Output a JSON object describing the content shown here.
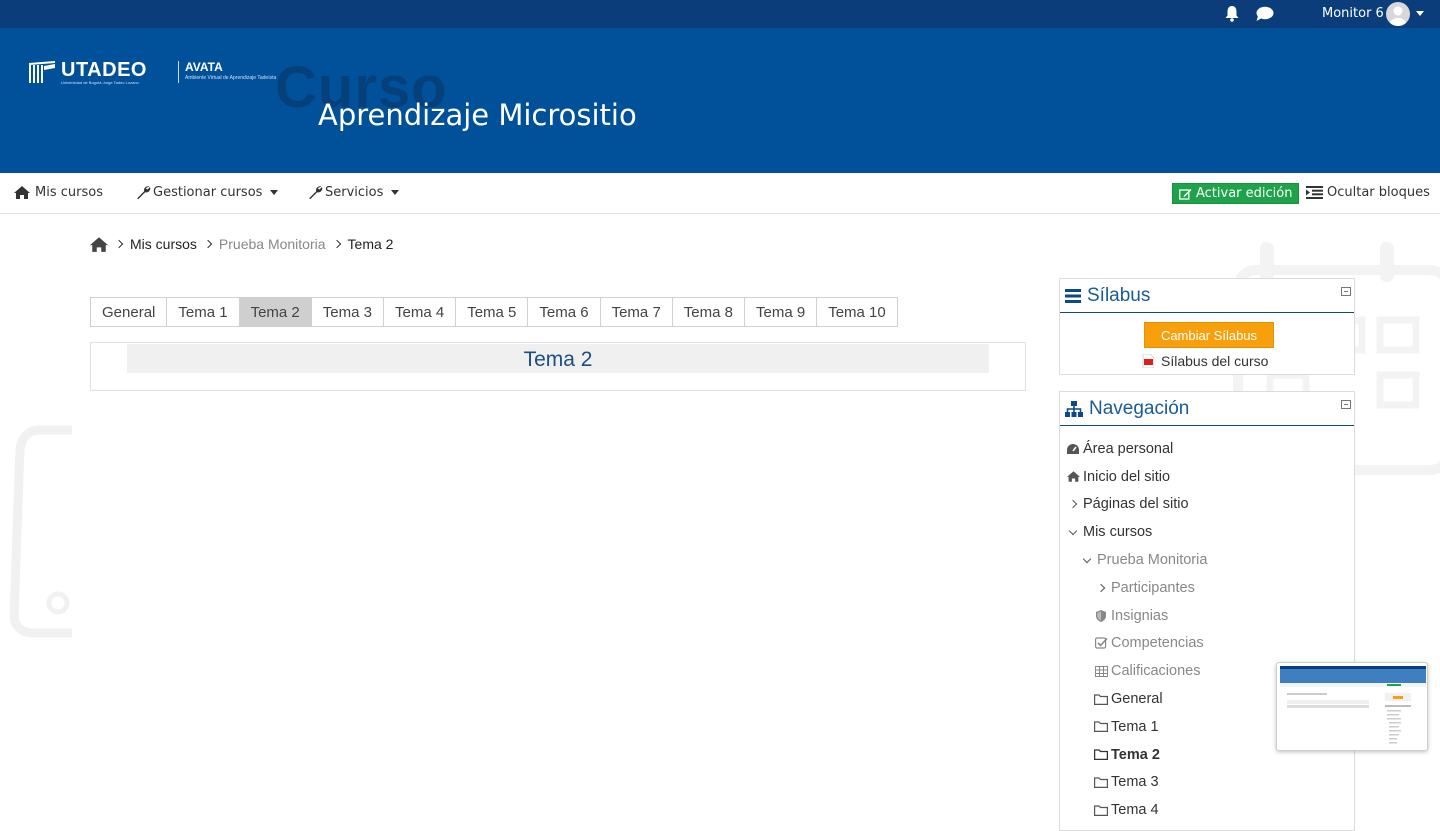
{
  "topbar": {
    "username": "Monitor 6"
  },
  "banner": {
    "logo_main": "UTADEO",
    "logo_sub": "Universidad de Bogotá Jorge Tadeo Lozano",
    "logo_avata": "AVATA",
    "logo_avata_sub": "Ambiente Virtual de Aprendizaje Tadeísta",
    "ghost_word": "Curso",
    "course_title": "Aprendizaje Micrositio"
  },
  "navbar": {
    "my_courses": "Mis cursos",
    "manage_courses": "Gestionar cursos",
    "services": "Servicios",
    "edit_mode": "Activar edición",
    "hide_blocks": "Ocultar bloques"
  },
  "breadcrumb": {
    "items": [
      "Mis cursos",
      "Prueba Monitoria",
      "Tema 2"
    ]
  },
  "tabs": {
    "items": [
      "General",
      "Tema 1",
      "Tema 2",
      "Tema 3",
      "Tema 4",
      "Tema 5",
      "Tema 6",
      "Tema 7",
      "Tema 8",
      "Tema 9",
      "Tema 10"
    ],
    "active": "Tema 2"
  },
  "section": {
    "title": "Tema 2"
  },
  "silabus": {
    "title": "Sílabus",
    "button": "Cambiar Sílabus",
    "link": "Sílabus del curso"
  },
  "navigation": {
    "title": "Navegación",
    "items": [
      {
        "label": "Área personal"
      },
      {
        "label": "Inicio del sitio"
      },
      {
        "label": "Páginas del sitio"
      },
      {
        "label": "Mis cursos"
      },
      {
        "label": "Prueba Monitoria"
      },
      {
        "label": "Participantes"
      },
      {
        "label": "Insignias"
      },
      {
        "label": "Competencias"
      },
      {
        "label": "Calificaciones"
      },
      {
        "label": "General"
      },
      {
        "label": "Tema 1"
      },
      {
        "label": "Tema 2"
      },
      {
        "label": "Tema 3"
      },
      {
        "label": "Tema 4"
      }
    ]
  },
  "colors": {
    "topbar": "#0a3d7a",
    "banner": "#00519a",
    "edit_button": "#1fa34a",
    "silabus_button": "#f7a00c",
    "block_title": "#1a5b96"
  }
}
